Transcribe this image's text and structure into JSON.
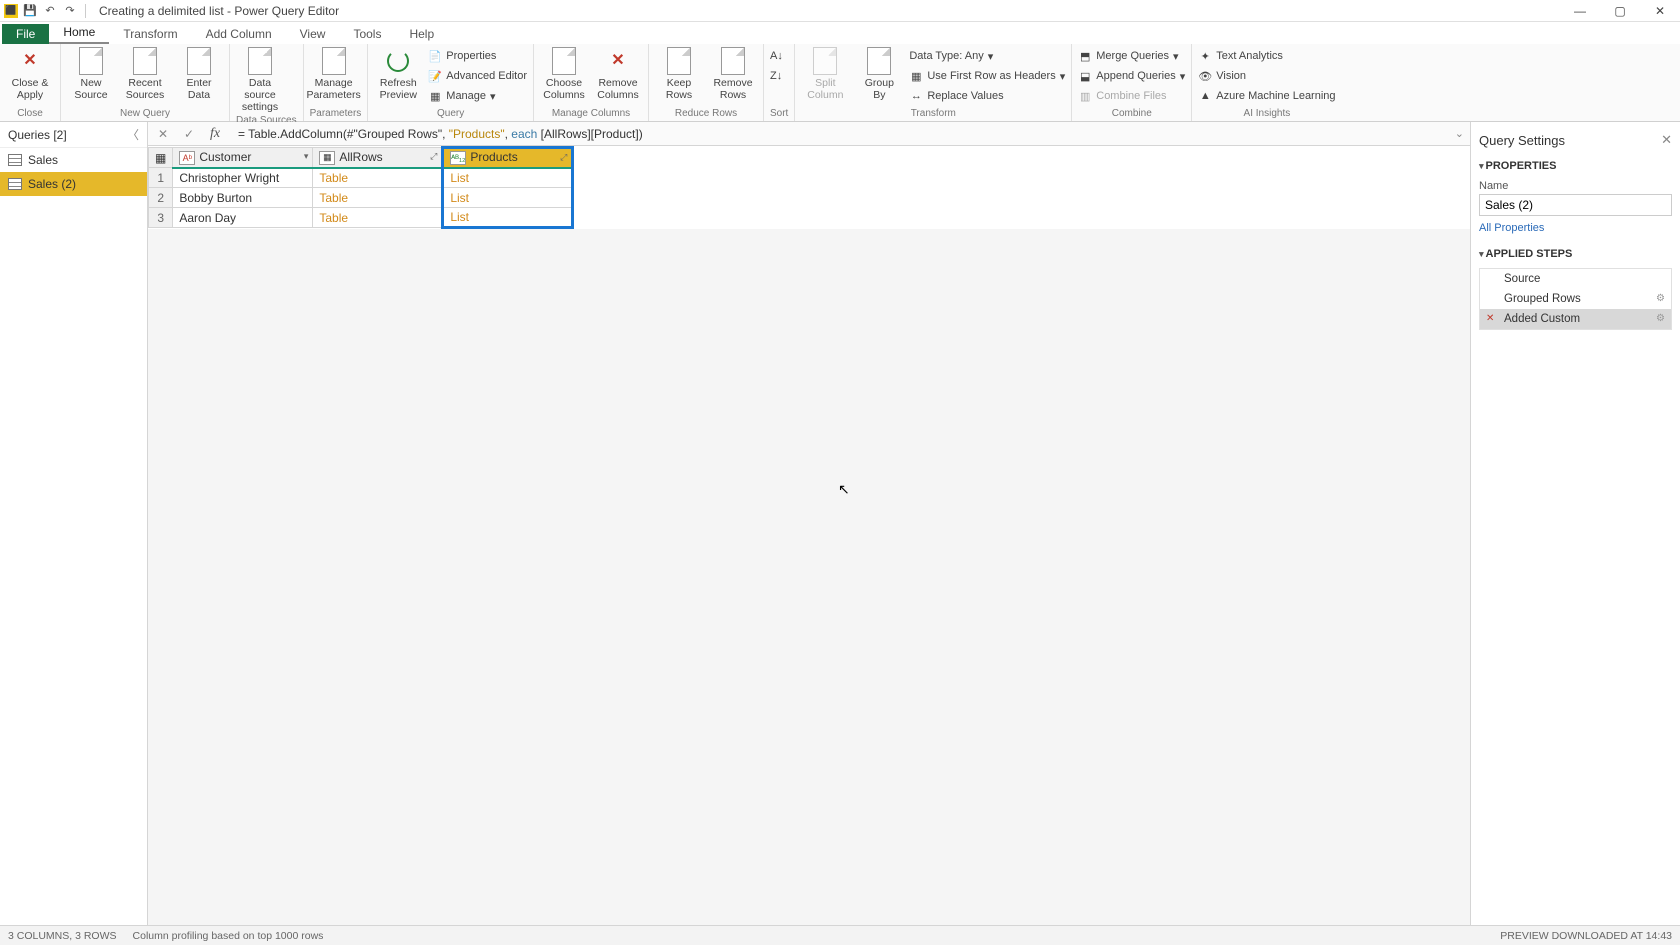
{
  "title": "Creating a delimited list - Power Query Editor",
  "tabs": {
    "file": "File",
    "home": "Home",
    "transform": "Transform",
    "addcolumn": "Add Column",
    "view": "View",
    "tools": "Tools",
    "help": "Help"
  },
  "ribbon": {
    "close": {
      "btn": "Close &\nApply",
      "group": "Close"
    },
    "newquery": {
      "new": "New\nSource",
      "recent": "Recent\nSources",
      "enter": "Enter\nData",
      "group": "New Query"
    },
    "datasources": {
      "btn": "Data source\nsettings",
      "group": "Data Sources"
    },
    "parameters": {
      "btn": "Manage\nParameters",
      "group": "Parameters"
    },
    "query": {
      "refresh": "Refresh\nPreview",
      "properties": "Properties",
      "advanced": "Advanced Editor",
      "manage": "Manage",
      "group": "Query"
    },
    "managecols": {
      "choose": "Choose\nColumns",
      "remove": "Remove\nColumns",
      "group": "Manage Columns"
    },
    "reducerows": {
      "keep": "Keep\nRows",
      "remove": "Remove\nRows",
      "group": "Reduce Rows"
    },
    "sort": {
      "group": "Sort"
    },
    "transform": {
      "split": "Split\nColumn",
      "group_btn": "Group\nBy",
      "datatype": "Data Type: Any",
      "firstrow": "Use First Row as Headers",
      "replace": "Replace Values",
      "group": "Transform"
    },
    "combine": {
      "merge": "Merge Queries",
      "append": "Append Queries",
      "files": "Combine Files",
      "group": "Combine"
    },
    "ai": {
      "text": "Text Analytics",
      "vision": "Vision",
      "ml": "Azure Machine Learning",
      "group": "AI Insights"
    }
  },
  "queries": {
    "header": "Queries [2]",
    "items": [
      "Sales",
      "Sales (2)"
    ]
  },
  "formula": {
    "prefix": "= Table.AddColumn(#\"Grouped Rows\", ",
    "str": "\"Products\"",
    "mid": ", ",
    "kw": "each",
    "suffix": " [AllRows][Product])"
  },
  "grid": {
    "columns": [
      "Customer",
      "AllRows",
      "Products"
    ],
    "rows": [
      {
        "n": "1",
        "customer": "Christopher Wright",
        "allrows": "Table",
        "products": "List"
      },
      {
        "n": "2",
        "customer": "Bobby Burton",
        "allrows": "Table",
        "products": "List"
      },
      {
        "n": "3",
        "customer": "Aaron Day",
        "allrows": "Table",
        "products": "List"
      }
    ]
  },
  "settings": {
    "title": "Query Settings",
    "properties": "PROPERTIES",
    "name_label": "Name",
    "name_value": "Sales (2)",
    "all_props": "All Properties",
    "applied": "APPLIED STEPS",
    "steps": [
      "Source",
      "Grouped Rows",
      "Added Custom"
    ]
  },
  "status": {
    "left": "3 COLUMNS, 3 ROWS",
    "mid": "Column profiling based on top 1000 rows",
    "right": "PREVIEW DOWNLOADED AT 14:43"
  }
}
